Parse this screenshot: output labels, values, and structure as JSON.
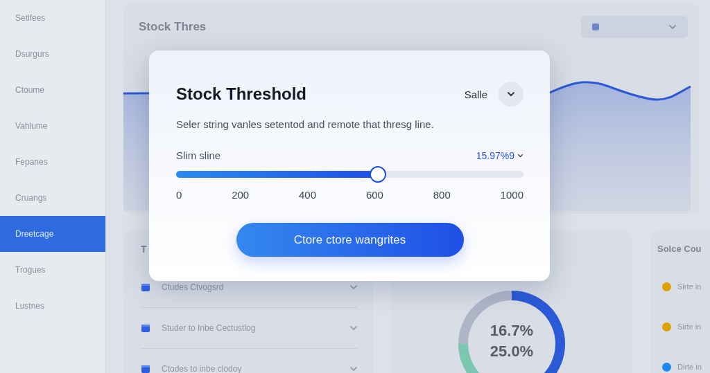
{
  "sidebar": {
    "items": [
      {
        "label": "Setlfees",
        "selected": false
      },
      {
        "label": "Dsurgurs",
        "selected": false
      },
      {
        "label": "Ctoume",
        "selected": false
      },
      {
        "label": "Vahlume",
        "selected": false
      },
      {
        "label": "Fepanes",
        "selected": false
      },
      {
        "label": "Cruangs",
        "selected": false
      },
      {
        "label": "Dreetcage",
        "selected": true
      },
      {
        "label": "Trogues",
        "selected": false
      },
      {
        "label": "Lustnes",
        "selected": false
      }
    ]
  },
  "dashboard": {
    "chart_card": {
      "title": "Stock Thres"
    },
    "list_card": {
      "title": "T",
      "items": [
        {
          "label": "Ctudes Ctvogsrd"
        },
        {
          "label": "Studer to Inbe Cectustlog"
        },
        {
          "label": "Ctodes to inbe clodoy"
        }
      ]
    },
    "donut_card": {
      "values": [
        "16.7%",
        "25.0%"
      ]
    },
    "status_card": {
      "title": "Solce Cou",
      "items": [
        {
          "label": "Sirte in",
          "color": "#e0a000"
        },
        {
          "label": "Sirte in",
          "color": "#e0a000"
        },
        {
          "label": "Dirte in",
          "color": "#1e88f0"
        }
      ]
    }
  },
  "modal": {
    "title": "Stock Threshold",
    "menu_label": "Salle",
    "description": "Seler string vanles setentod and remote that thresg line.",
    "slider": {
      "label": "Slim sline",
      "reading": "15.97%9",
      "level": 0.58,
      "ticks": [
        "0",
        "200",
        "400",
        "600",
        "800",
        "1000"
      ]
    },
    "button": "Ctore ctore wangrites"
  }
}
